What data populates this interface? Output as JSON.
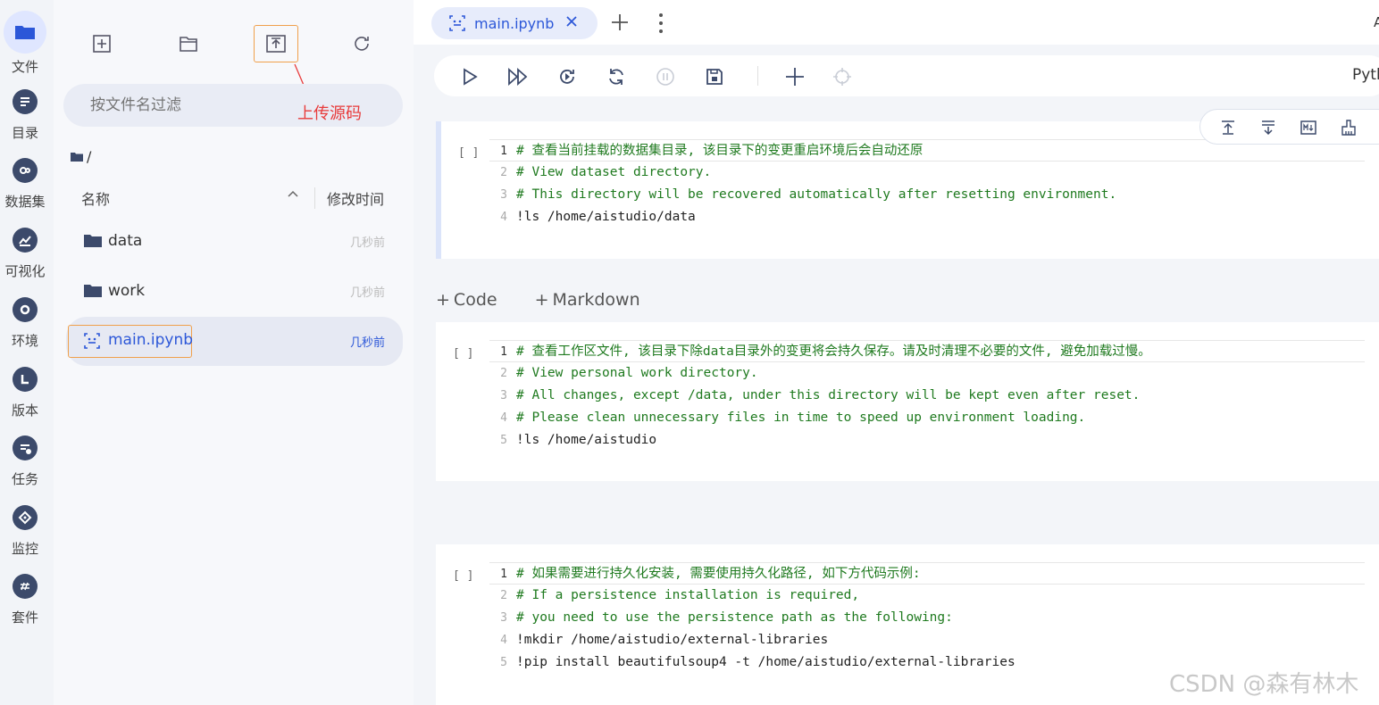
{
  "activity_bar": [
    {
      "label": "文件",
      "icon": "folder-icon",
      "active": true
    },
    {
      "label": "目录",
      "icon": "toc-icon"
    },
    {
      "label": "数据集",
      "icon": "dataset-icon"
    },
    {
      "label": "可视化",
      "icon": "chart-icon"
    },
    {
      "label": "环境",
      "icon": "environment-icon"
    },
    {
      "label": "版本",
      "icon": "version-icon"
    },
    {
      "label": "任务",
      "icon": "task-icon"
    },
    {
      "label": "监控",
      "icon": "monitor-icon"
    },
    {
      "label": "套件",
      "icon": "suite-icon"
    }
  ],
  "file_panel": {
    "filter_placeholder": "按文件名过滤",
    "annotation": "上传源码",
    "breadcrumb": "/",
    "col_name": "名称",
    "col_time": "修改时间",
    "files": [
      {
        "name": "data",
        "time": "几秒前",
        "type": "folder"
      },
      {
        "name": "work",
        "time": "几秒前",
        "type": "folder"
      },
      {
        "name": "main.ipynb",
        "time": "几秒前",
        "type": "notebook"
      }
    ]
  },
  "tabs": {
    "active": "main.ipynb",
    "right_text": "A"
  },
  "toolbar": {
    "kernel": "Pyth"
  },
  "add_cell": {
    "code": "Code",
    "markdown": "Markdown"
  },
  "cells": [
    {
      "prompt": "[ ]",
      "lines": [
        {
          "n": "1",
          "text": "# 查看当前挂载的数据集目录, 该目录下的变更重启环境后会自动还原",
          "kind": "cm"
        },
        {
          "n": "2",
          "text": "# View dataset directory.",
          "kind": "cm"
        },
        {
          "n": "3",
          "text": "# This directory will be recovered automatically after resetting environment.",
          "kind": "cm"
        },
        {
          "n": "4",
          "text": "!ls /home/aistudio/data",
          "kind": "cmd"
        }
      ]
    },
    {
      "prompt": "[ ]",
      "lines": [
        {
          "n": "1",
          "text": "# 查看工作区文件, 该目录下除data目录外的变更将会持久保存。请及时清理不必要的文件, 避免加载过慢。",
          "kind": "cm"
        },
        {
          "n": "2",
          "text": "# View personal work directory.",
          "kind": "cm"
        },
        {
          "n": "3",
          "text": "# All changes, except /data, under this directory will be kept even after reset.",
          "kind": "cm"
        },
        {
          "n": "4",
          "text": "# Please clean unnecessary files in time to speed up environment loading.",
          "kind": "cm"
        },
        {
          "n": "5",
          "text": "!ls /home/aistudio",
          "kind": "cmd"
        }
      ]
    },
    {
      "prompt": "[ ]",
      "lines": [
        {
          "n": "1",
          "text": "# 如果需要进行持久化安装, 需要使用持久化路径, 如下方代码示例:",
          "kind": "cm"
        },
        {
          "n": "2",
          "text": "# If a persistence installation is required,",
          "kind": "cm"
        },
        {
          "n": "3",
          "text": "# you need to use the persistence path as the following:",
          "kind": "cm"
        },
        {
          "n": "4",
          "text": "!mkdir /home/aistudio/external-libraries",
          "kind": "cmd"
        },
        {
          "n": "5",
          "text": "!pip install beautifulsoup4 -t /home/aistudio/external-libraries",
          "kind": "cmd"
        }
      ]
    }
  ],
  "watermark": "CSDN @森有林木",
  "colors": {
    "accent": "#2c57d8",
    "highlight": "#f0a04b",
    "annotation": "#e83b3b",
    "comment": "#1f7a1f"
  }
}
